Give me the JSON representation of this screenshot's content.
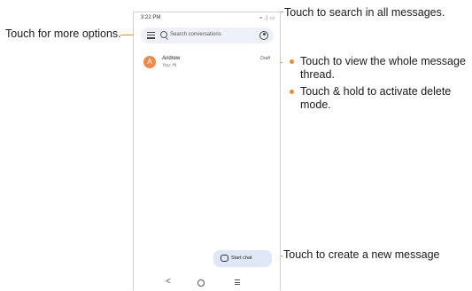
{
  "callouts": {
    "more_options": "Touch for more options.",
    "search": "Touch to search in all messages.",
    "thread_bullets": [
      "Touch to view the whole message thread.",
      "Touch & hold to activate delete mode."
    ],
    "new_message": "Touch to create a new message"
  },
  "phone": {
    "status_time": "3:22 PM",
    "status_icons": "≈ .∣ ▭",
    "search_placeholder": "Search conversations",
    "conversation": {
      "avatar_letter": "A",
      "name": "Andrew",
      "preview": "You: Hi",
      "status": "Draft"
    },
    "fab_label": "Start chat",
    "nav_back": "<"
  },
  "colors": {
    "accent_line": "#f08a2c",
    "avatar_bg": "#ef8a4a",
    "search_bg": "#eef1f7",
    "fab_bg": "#dfe8f6"
  }
}
